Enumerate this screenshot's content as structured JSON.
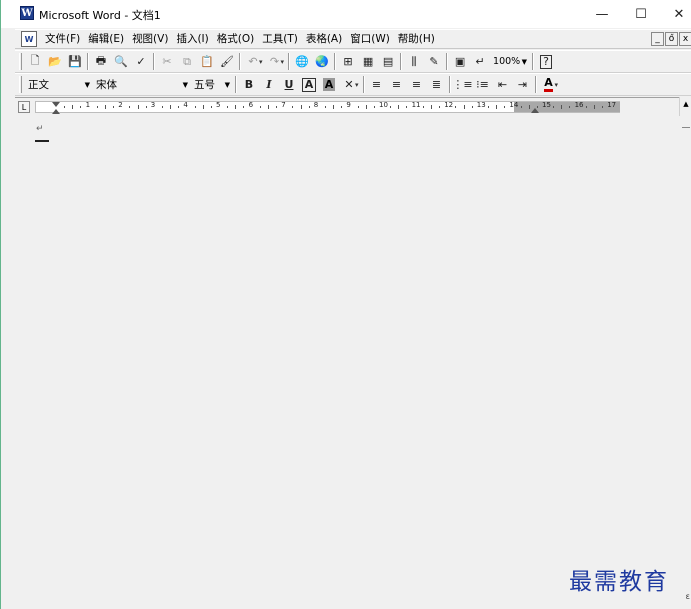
{
  "window": {
    "title": "Microsoft Word - 文档1",
    "app_icon_letter": "W",
    "minimize_glyph": "—",
    "maximize_glyph": "☐",
    "close_glyph": "✕"
  },
  "menu": {
    "items": [
      "文件(F)",
      "编辑(E)",
      "视图(V)",
      "插入(I)",
      "格式(O)",
      "工具(T)",
      "表格(A)",
      "窗口(W)",
      "帮助(H)"
    ],
    "mdi_minimize": "_",
    "mdi_restore": "ő",
    "mdi_close": "x"
  },
  "toolbar_standard": {
    "new_icon": "🗋",
    "open_icon": "📂",
    "save_icon": "💾",
    "print_icon": "🖶",
    "preview_icon": "🔍",
    "spell_icon": "✓",
    "cut_icon": "✂",
    "copy_icon": "⧉",
    "paste_icon": "📋",
    "format_painter_icon": "🖌",
    "undo_icon": "↶",
    "redo_icon": "↷",
    "hyperlink_icon": "🌐",
    "web_icon": "🌏",
    "tables_icon": "⊞",
    "insert_table_icon": "▦",
    "excel_icon": "▤",
    "columns_icon": "⫼",
    "drawing_icon": "✎",
    "doc_map_icon": "▣",
    "show_hide_icon": "↵",
    "zoom_value": "100%",
    "help_icon": "?"
  },
  "toolbar_formatting": {
    "style_value": "正文",
    "font_value": "宋体",
    "size_value": "五号",
    "bold_label": "B",
    "italic_label": "I",
    "underline_label": "U",
    "char_border_label": "A",
    "char_shading_label": "A",
    "char_scale_icon": "✕",
    "align_left_icon": "≡",
    "align_center_icon": "≡",
    "align_right_icon": "≡",
    "justify_icon": "≣",
    "numbering_icon": "⋮≡",
    "bullets_icon": "⁝≡",
    "decrease_indent_icon": "⇤",
    "increase_indent_icon": "⇥",
    "font_color_label": "A"
  },
  "ruler": {
    "numbers": [
      "1",
      "2",
      "3",
      "4",
      "5",
      "6",
      "7",
      "8",
      "9",
      "10",
      "11",
      "12",
      "13",
      "14",
      "15",
      "16",
      "17"
    ],
    "tab_selector": "L"
  },
  "document": {
    "paragraph_mark": "↵"
  },
  "watermark": {
    "text": "最需教育",
    "small_text": "ε"
  }
}
